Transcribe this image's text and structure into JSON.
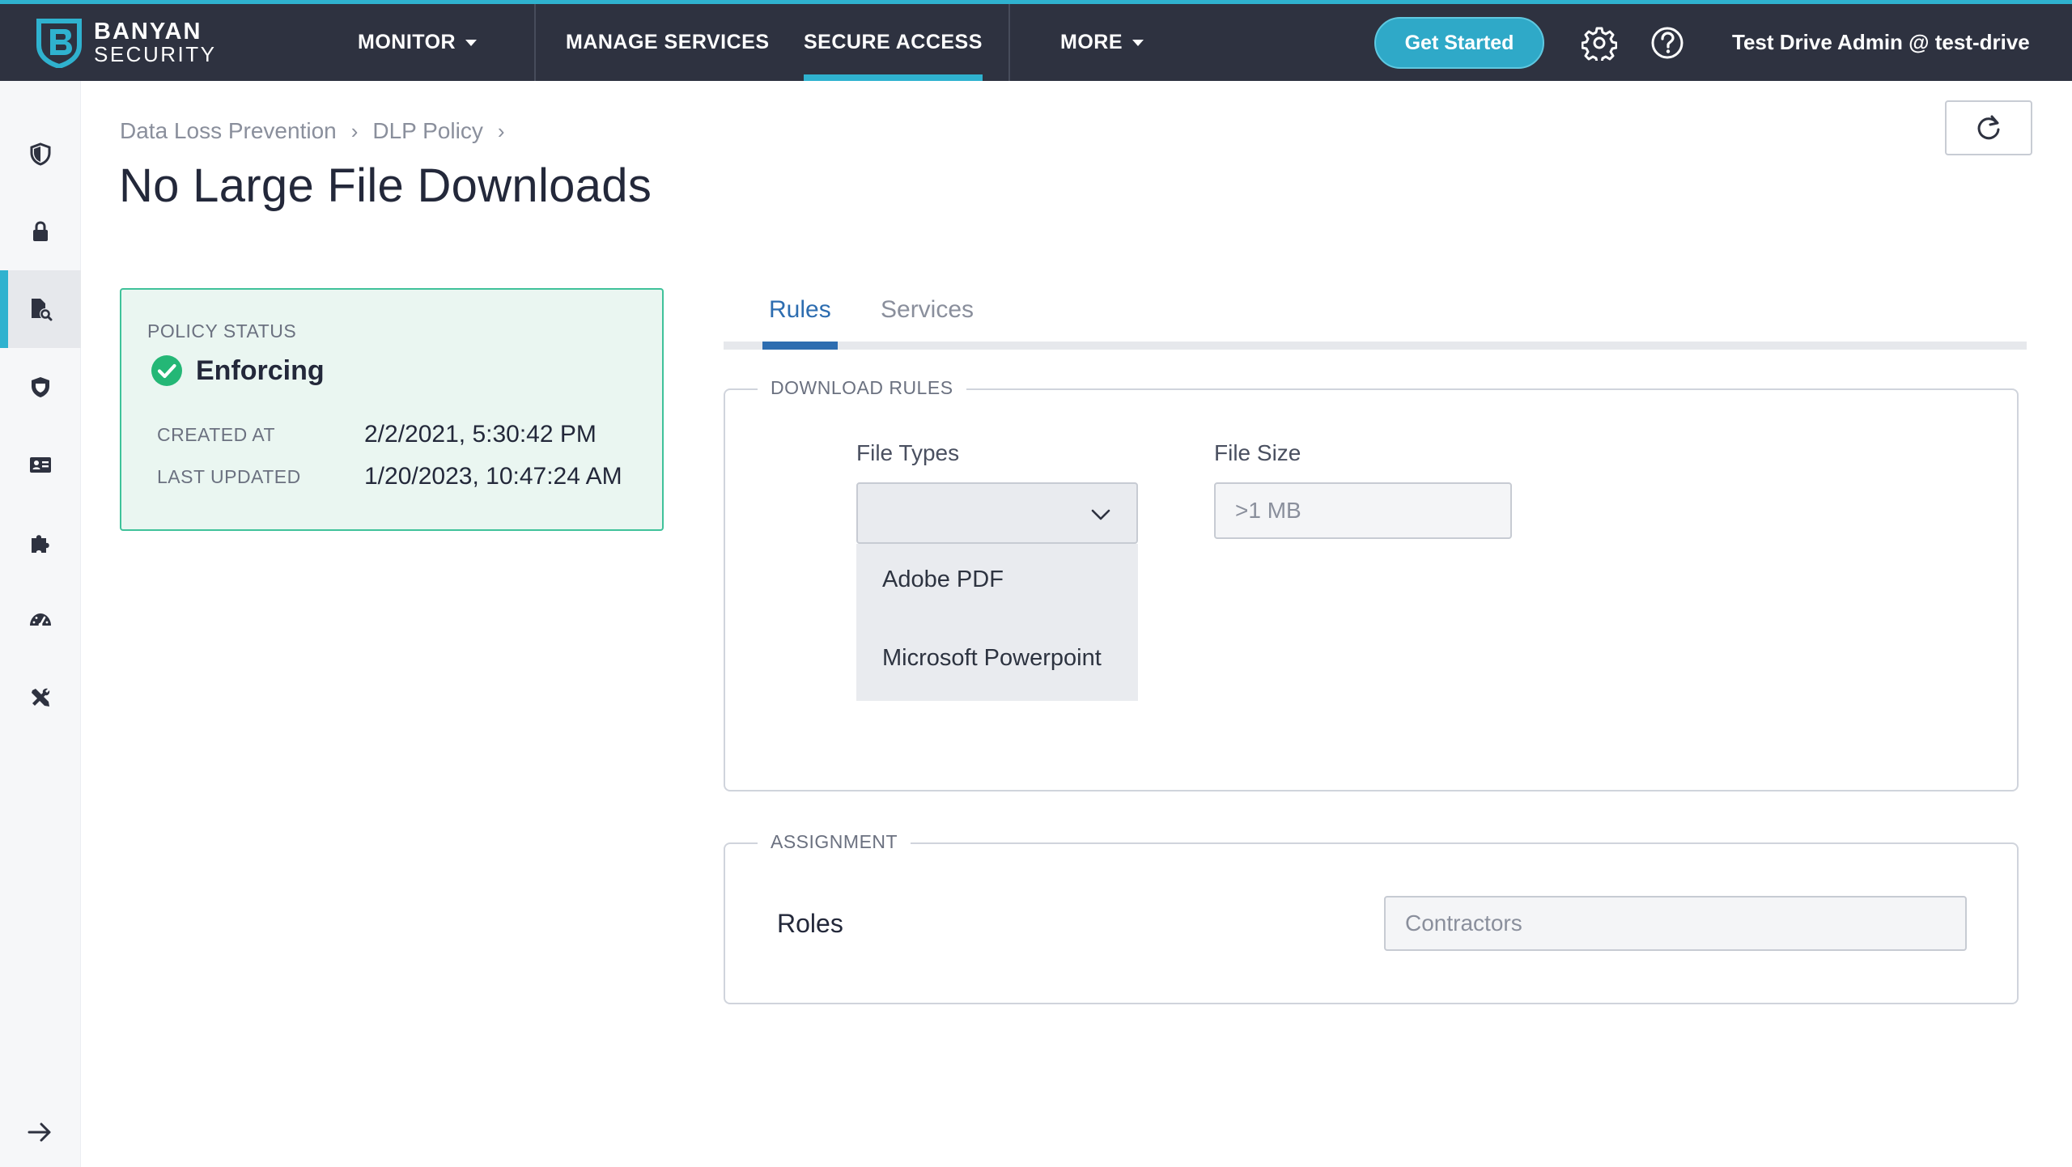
{
  "brand": {
    "name_line1": "BANYAN",
    "name_line2": "SECURITY",
    "accent_color": "#2fb2cf"
  },
  "nav": {
    "items": [
      {
        "label": "MONITOR",
        "has_dropdown": true
      },
      {
        "label": "MANAGE SERVICES",
        "has_dropdown": false
      },
      {
        "label": "SECURE ACCESS",
        "has_dropdown": false,
        "active": true
      },
      {
        "label": "MORE",
        "has_dropdown": true
      }
    ],
    "get_started": "Get Started",
    "user": "Test Drive Admin @ test-drive",
    "icons": [
      "gear-icon",
      "help-icon"
    ]
  },
  "sidebar": {
    "items": [
      {
        "icon": "shield-half-icon"
      },
      {
        "icon": "lock-icon"
      },
      {
        "icon": "file-search-icon",
        "active": true
      },
      {
        "icon": "shield-badge-icon"
      },
      {
        "icon": "id-card-icon"
      },
      {
        "icon": "puzzle-icon"
      },
      {
        "icon": "dashboard-gauge-icon"
      },
      {
        "icon": "tools-icon"
      }
    ],
    "expand_icon": "arrow-right-icon"
  },
  "breadcrumb": {
    "items": [
      "Data Loss Prevention",
      "DLP Policy"
    ]
  },
  "page": {
    "title": "No Large File Downloads"
  },
  "status": {
    "label": "POLICY STATUS",
    "value": "Enforcing",
    "created_label": "CREATED AT",
    "created_value": "2/2/2021, 5:30:42 PM",
    "updated_label": "LAST UPDATED",
    "updated_value": "1/20/2023, 10:47:24 AM",
    "color": "#3fc29a"
  },
  "tabs": [
    {
      "label": "Rules",
      "active": true
    },
    {
      "label": "Services",
      "active": false
    }
  ],
  "download_rules": {
    "legend": "DOWNLOAD RULES",
    "file_types_label": "File Types",
    "file_types_options": [
      "Adobe PDF",
      "Microsoft Powerpoint"
    ],
    "file_size_label": "File Size",
    "file_size_value": ">1 MB"
  },
  "assignment": {
    "legend": "ASSIGNMENT",
    "roles_label": "Roles",
    "roles_value": "Contractors"
  }
}
